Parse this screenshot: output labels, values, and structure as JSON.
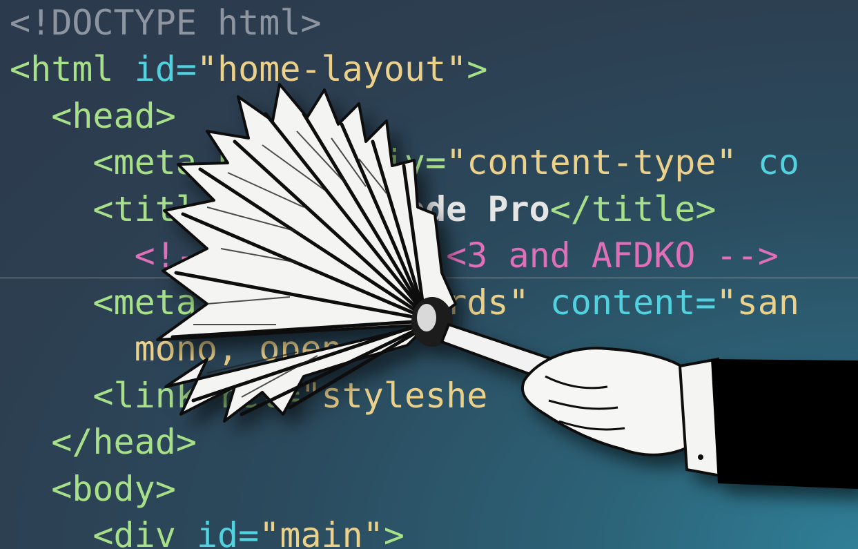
{
  "code_lines": [
    {
      "indent": "",
      "tokens": [
        {
          "t": "<!DOCTYPE html>",
          "c": "gray"
        }
      ]
    },
    {
      "indent": "",
      "tokens": [
        {
          "t": "<html",
          "c": "tag"
        },
        {
          "t": " id=",
          "c": "attr"
        },
        {
          "t": "\"home-layout\"",
          "c": "str"
        },
        {
          "t": ">",
          "c": "tag"
        }
      ]
    },
    {
      "indent": "  ",
      "tokens": [
        {
          "t": "<head>",
          "c": "tag"
        }
      ]
    },
    {
      "indent": "    ",
      "tokens": [
        {
          "t": "<meta http-equiv=",
          "c": "tag"
        },
        {
          "t": "\"content-type\"",
          "c": "str"
        },
        {
          "t": " co",
          "c": "attr"
        }
      ]
    },
    {
      "indent": "    ",
      "tokens": [
        {
          "t": "<title>",
          "c": "tag"
        },
        {
          "t": "Source Code Pro",
          "c": "txt"
        },
        {
          "t": "</title>",
          "c": "tag"
        }
      ]
    },
    {
      "indent": "      ",
      "tokens": [
        {
          "t": "<!-- made with <3 and AFDKO -->",
          "c": "cmt"
        }
      ]
    },
    {
      "indent": "    ",
      "tokens": [
        {
          "t": "<meta name=",
          "c": "tag"
        },
        {
          "t": "\"keywords\"",
          "c": "str"
        },
        {
          "t": " content=",
          "c": "attr"
        },
        {
          "t": "\"san",
          "c": "str"
        }
      ]
    },
    {
      "indent": "      ",
      "tokens": [
        {
          "t": "mono, open",
          "c": "str"
        }
      ]
    },
    {
      "indent": "    ",
      "tokens": [
        {
          "t": "<link rel=",
          "c": "tag"
        },
        {
          "t": "\"styleshe",
          "c": "str"
        }
      ]
    },
    {
      "indent": "  ",
      "tokens": [
        {
          "t": "</head>",
          "c": "tag"
        }
      ]
    },
    {
      "indent": "  ",
      "tokens": [
        {
          "t": "<body>",
          "c": "tag"
        }
      ]
    },
    {
      "indent": "    ",
      "tokens": [
        {
          "t": "<div",
          "c": "tag"
        },
        {
          "t": " id=",
          "c": "attr"
        },
        {
          "t": "\"main\"",
          "c": "str"
        },
        {
          "t": ">",
          "c": "tag"
        }
      ]
    }
  ]
}
